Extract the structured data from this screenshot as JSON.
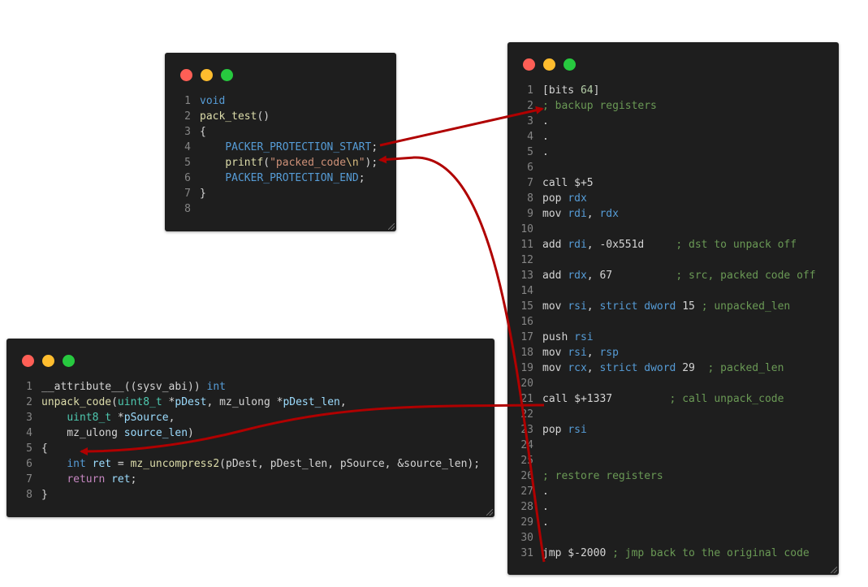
{
  "colors": {
    "background": "#ffffff",
    "window": "#1e1e1e",
    "arrow": "#b00000",
    "dot_red": "#ff5f56",
    "dot_yellow": "#ffbd2e",
    "dot_green": "#27c93f",
    "keyword": "#569cd6",
    "function": "#dcdcaa",
    "string": "#ce9178",
    "comment": "#6a9955",
    "number": "#b5cea8"
  },
  "windows": {
    "pack_test": {
      "lines": [
        {
          "n": "1",
          "t": [
            [
              "void",
              "k"
            ]
          ]
        },
        {
          "n": "2",
          "t": [
            [
              "pack_test",
              "f"
            ],
            [
              "()",
              "d"
            ]
          ]
        },
        {
          "n": "3",
          "t": [
            [
              "{",
              "d"
            ]
          ]
        },
        {
          "n": "4",
          "t": [
            [
              "    ",
              "d"
            ],
            [
              "PACKER_PROTECTION_START",
              "k"
            ],
            [
              ";",
              "d"
            ]
          ]
        },
        {
          "n": "5",
          "t": [
            [
              "    ",
              "d"
            ],
            [
              "printf",
              "f"
            ],
            [
              "(",
              "d"
            ],
            [
              "\"packed_code",
              "s"
            ],
            [
              "\\n",
              "e"
            ],
            [
              "\"",
              "s"
            ],
            [
              ");",
              "d"
            ]
          ]
        },
        {
          "n": "6",
          "t": [
            [
              "    ",
              "d"
            ],
            [
              "PACKER_PROTECTION_END",
              "k"
            ],
            [
              ";",
              "d"
            ]
          ]
        },
        {
          "n": "7",
          "t": [
            [
              "}",
              "d"
            ]
          ]
        },
        {
          "n": "8",
          "t": []
        }
      ]
    },
    "unpack_code": {
      "lines": [
        {
          "n": "1",
          "t": [
            [
              "__attribute__((sysv_abi)) ",
              "d"
            ],
            [
              "int",
              "k"
            ]
          ]
        },
        {
          "n": "2",
          "t": [
            [
              "unpack_code",
              "f"
            ],
            [
              "(",
              "d"
            ],
            [
              "uint8_t",
              "t"
            ],
            [
              " *",
              "d"
            ],
            [
              "pDest",
              "v"
            ],
            [
              ", mz_ulong *",
              "d"
            ],
            [
              "pDest_len",
              "v"
            ],
            [
              ",",
              "d"
            ]
          ]
        },
        {
          "n": "3",
          "t": [
            [
              "    ",
              "d"
            ],
            [
              "uint8_t",
              "t"
            ],
            [
              " *",
              "d"
            ],
            [
              "pSource",
              "v"
            ],
            [
              ",",
              "d"
            ]
          ]
        },
        {
          "n": "4",
          "t": [
            [
              "    mz_ulong ",
              "d"
            ],
            [
              "source_len",
              "v"
            ],
            [
              ")",
              "d"
            ]
          ]
        },
        {
          "n": "5",
          "t": [
            [
              "{",
              "d"
            ]
          ]
        },
        {
          "n": "6",
          "t": [
            [
              "    ",
              "d"
            ],
            [
              "int",
              "k"
            ],
            [
              " ",
              "d"
            ],
            [
              "ret",
              "v"
            ],
            [
              " = ",
              "d"
            ],
            [
              "mz_uncompress2",
              "f"
            ],
            [
              "(pDest, pDest_len, pSource, &source_len);",
              "d"
            ]
          ]
        },
        {
          "n": "7",
          "t": [
            [
              "    ",
              "d"
            ],
            [
              "return",
              "p"
            ],
            [
              " ",
              "d"
            ],
            [
              "ret",
              "v"
            ],
            [
              ";",
              "d"
            ]
          ]
        },
        {
          "n": "8",
          "t": [
            [
              "}",
              "d"
            ]
          ]
        }
      ]
    },
    "asm": {
      "lines": [
        {
          "n": "1",
          "t": [
            [
              "[bits ",
              "d"
            ],
            [
              "64",
              "n"
            ],
            [
              "]",
              "d"
            ]
          ]
        },
        {
          "n": "2",
          "t": [
            [
              "; backup registers",
              "c"
            ]
          ]
        },
        {
          "n": "3",
          "t": [
            [
              ".",
              "d"
            ]
          ]
        },
        {
          "n": "4",
          "t": [
            [
              ".",
              "d"
            ]
          ]
        },
        {
          "n": "5",
          "t": [
            [
              ".",
              "d"
            ]
          ]
        },
        {
          "n": "6",
          "t": []
        },
        {
          "n": "7",
          "t": [
            [
              "call $+5",
              "d"
            ]
          ]
        },
        {
          "n": "8",
          "t": [
            [
              "pop ",
              "d"
            ],
            [
              "rdx",
              "k"
            ]
          ]
        },
        {
          "n": "9",
          "t": [
            [
              "mov ",
              "d"
            ],
            [
              "rdi",
              "k"
            ],
            [
              ", ",
              "d"
            ],
            [
              "rdx",
              "k"
            ]
          ]
        },
        {
          "n": "10",
          "t": []
        },
        {
          "n": "11",
          "t": [
            [
              "add ",
              "d"
            ],
            [
              "rdi",
              "k"
            ],
            [
              ", -0x551d     ",
              "d"
            ],
            [
              "; dst to unpack off",
              "c"
            ]
          ]
        },
        {
          "n": "12",
          "t": []
        },
        {
          "n": "13",
          "t": [
            [
              "add ",
              "d"
            ],
            [
              "rdx",
              "k"
            ],
            [
              ", 67          ",
              "d"
            ],
            [
              "; src, packed code off",
              "c"
            ]
          ]
        },
        {
          "n": "14",
          "t": []
        },
        {
          "n": "15",
          "t": [
            [
              "mov ",
              "d"
            ],
            [
              "rsi",
              "k"
            ],
            [
              ", ",
              "d"
            ],
            [
              "strict dword",
              "k"
            ],
            [
              " 15 ",
              "d"
            ],
            [
              "; unpacked_len",
              "c"
            ]
          ]
        },
        {
          "n": "16",
          "t": []
        },
        {
          "n": "17",
          "t": [
            [
              "push ",
              "d"
            ],
            [
              "rsi",
              "k"
            ]
          ]
        },
        {
          "n": "18",
          "t": [
            [
              "mov ",
              "d"
            ],
            [
              "rsi",
              "k"
            ],
            [
              ", ",
              "d"
            ],
            [
              "rsp",
              "k"
            ]
          ]
        },
        {
          "n": "19",
          "t": [
            [
              "mov ",
              "d"
            ],
            [
              "rcx",
              "k"
            ],
            [
              ", ",
              "d"
            ],
            [
              "strict dword",
              "k"
            ],
            [
              " 29  ",
              "d"
            ],
            [
              "; packed_len",
              "c"
            ]
          ]
        },
        {
          "n": "20",
          "t": []
        },
        {
          "n": "21",
          "t": [
            [
              "call $+1337         ",
              "d"
            ],
            [
              "; call unpack_code",
              "c"
            ]
          ]
        },
        {
          "n": "22",
          "t": []
        },
        {
          "n": "23",
          "t": [
            [
              "pop ",
              "d"
            ],
            [
              "rsi",
              "k"
            ]
          ]
        },
        {
          "n": "24",
          "t": []
        },
        {
          "n": "25",
          "t": []
        },
        {
          "n": "26",
          "t": [
            [
              "; restore registers",
              "c"
            ]
          ]
        },
        {
          "n": "27",
          "t": [
            [
              ".",
              "d"
            ]
          ]
        },
        {
          "n": "28",
          "t": [
            [
              ".",
              "d"
            ]
          ]
        },
        {
          "n": "29",
          "t": [
            [
              ".",
              "d"
            ]
          ]
        },
        {
          "n": "30",
          "t": []
        },
        {
          "n": "31",
          "t": [
            [
              "jmp $-2000 ",
              "d"
            ],
            [
              "; jmp back to the original code",
              "c"
            ]
          ]
        }
      ]
    }
  }
}
